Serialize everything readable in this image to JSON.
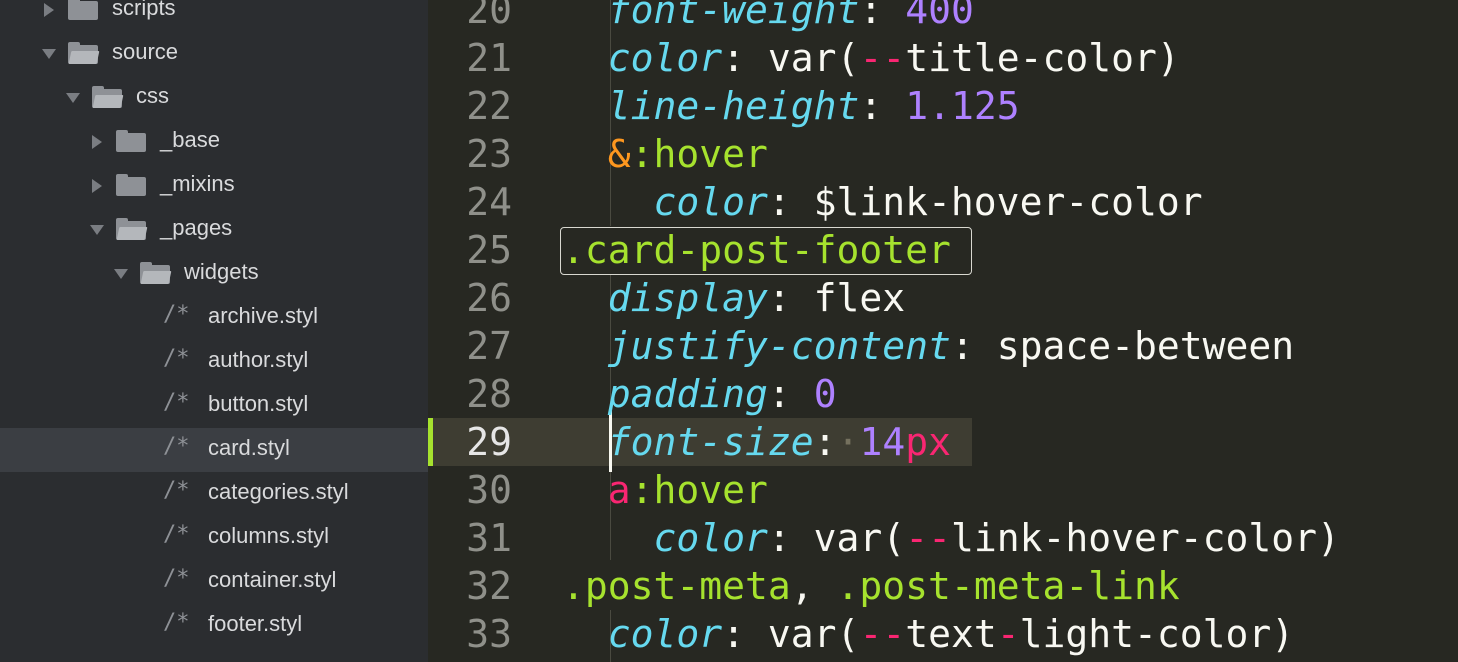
{
  "sidebar": {
    "items": [
      {
        "label": "scripts",
        "kind": "folder",
        "state": "closed",
        "depth": 1,
        "icon": "folder-icon"
      },
      {
        "label": "source",
        "kind": "folder",
        "state": "open",
        "depth": 1,
        "icon": "folder-open-icon"
      },
      {
        "label": "css",
        "kind": "folder",
        "state": "open",
        "depth": 2,
        "icon": "folder-open-icon"
      },
      {
        "label": "_base",
        "kind": "folder",
        "state": "closed",
        "depth": 3,
        "icon": "folder-icon"
      },
      {
        "label": "_mixins",
        "kind": "folder",
        "state": "closed",
        "depth": 3,
        "icon": "folder-icon"
      },
      {
        "label": "_pages",
        "kind": "folder",
        "state": "open",
        "depth": 3,
        "icon": "folder-open-icon"
      },
      {
        "label": "widgets",
        "kind": "folder",
        "state": "open",
        "depth": 4,
        "icon": "folder-open-icon"
      },
      {
        "label": "archive.styl",
        "kind": "file",
        "depth": 5,
        "icon_glyph": "/*"
      },
      {
        "label": "author.styl",
        "kind": "file",
        "depth": 5,
        "icon_glyph": "/*"
      },
      {
        "label": "button.styl",
        "kind": "file",
        "depth": 5,
        "icon_glyph": "/*"
      },
      {
        "label": "card.styl",
        "kind": "file",
        "depth": 5,
        "icon_glyph": "/*",
        "selected": true
      },
      {
        "label": "categories.styl",
        "kind": "file",
        "depth": 5,
        "icon_glyph": "/*"
      },
      {
        "label": "columns.styl",
        "kind": "file",
        "depth": 5,
        "icon_glyph": "/*"
      },
      {
        "label": "container.styl",
        "kind": "file",
        "depth": 5,
        "icon_glyph": "/*"
      },
      {
        "label": "footer.styl",
        "kind": "file",
        "depth": 5,
        "icon_glyph": "/*"
      }
    ]
  },
  "editor": {
    "current_line": 29,
    "line_numbers": [
      "20",
      "21",
      "22",
      "23",
      "24",
      "25",
      "26",
      "27",
      "28",
      "29",
      "30",
      "31",
      "32",
      "33"
    ],
    "lines": [
      {
        "n": "20",
        "tokens": [
          [
            "  ",
            "plain"
          ],
          [
            "font-weight",
            "prop"
          ],
          [
            ": ",
            "plain"
          ],
          [
            "400",
            "num"
          ]
        ]
      },
      {
        "n": "21",
        "tokens": [
          [
            "  ",
            "plain"
          ],
          [
            "color",
            "prop"
          ],
          [
            ": var(",
            "plain"
          ],
          [
            "--",
            "op"
          ],
          [
            "title-color)",
            "plain"
          ]
        ]
      },
      {
        "n": "22",
        "tokens": [
          [
            "  ",
            "plain"
          ],
          [
            "line-height",
            "prop"
          ],
          [
            ": ",
            "plain"
          ],
          [
            "1.125",
            "num"
          ]
        ]
      },
      {
        "n": "23",
        "tokens": [
          [
            "  ",
            "plain"
          ],
          [
            "&",
            "amp"
          ],
          [
            ":hover",
            "sel"
          ]
        ]
      },
      {
        "n": "24",
        "tokens": [
          [
            "    ",
            "plain"
          ],
          [
            "color",
            "prop"
          ],
          [
            ": $link-hover-color",
            "plain"
          ]
        ]
      },
      {
        "n": "25",
        "tokens": [
          [
            ".card-post-footer",
            "sel"
          ]
        ]
      },
      {
        "n": "26",
        "tokens": [
          [
            "  ",
            "plain"
          ],
          [
            "display",
            "prop"
          ],
          [
            ": flex",
            "plain"
          ]
        ]
      },
      {
        "n": "27",
        "tokens": [
          [
            "  ",
            "plain"
          ],
          [
            "justify-content",
            "prop"
          ],
          [
            ": space-between",
            "plain"
          ]
        ]
      },
      {
        "n": "28",
        "tokens": [
          [
            "  ",
            "plain"
          ],
          [
            "padding",
            "prop"
          ],
          [
            ": ",
            "plain"
          ],
          [
            "0",
            "num"
          ]
        ]
      },
      {
        "n": "29",
        "tokens": [
          [
            "  ",
            "plain"
          ],
          [
            "font-size",
            "prop"
          ],
          [
            ":",
            "plain"
          ],
          [
            "·",
            "ws"
          ],
          [
            "14",
            "num"
          ],
          [
            "px",
            "unit"
          ]
        ]
      },
      {
        "n": "30",
        "tokens": [
          [
            "  ",
            "plain"
          ],
          [
            "a",
            "tag"
          ],
          [
            ":hover",
            "sel"
          ]
        ]
      },
      {
        "n": "31",
        "tokens": [
          [
            "    ",
            "plain"
          ],
          [
            "color",
            "prop"
          ],
          [
            ": var(",
            "plain"
          ],
          [
            "--",
            "op"
          ],
          [
            "link-hover-color)",
            "plain"
          ]
        ]
      },
      {
        "n": "32",
        "tokens": [
          [
            ".post-meta",
            "sel"
          ],
          [
            ", ",
            "plain"
          ],
          [
            ".post-meta-link",
            "sel"
          ]
        ]
      },
      {
        "n": "33",
        "tokens": [
          [
            "  ",
            "plain"
          ],
          [
            "color",
            "prop"
          ],
          [
            ": var(",
            "plain"
          ],
          [
            "--",
            "op"
          ],
          [
            "text",
            "plain"
          ],
          [
            "-",
            "op"
          ],
          [
            "light-color)",
            "plain"
          ]
        ]
      }
    ]
  },
  "colors": {
    "sidebar_bg": "#2b2d30",
    "editor_bg": "#272822",
    "selected_row": "#3b3e43",
    "property": "#66d9ef",
    "number": "#ae81ff",
    "selector": "#a6e22e",
    "operator": "#f92672",
    "ampersand": "#fd971f",
    "text": "#f8f8f2"
  }
}
